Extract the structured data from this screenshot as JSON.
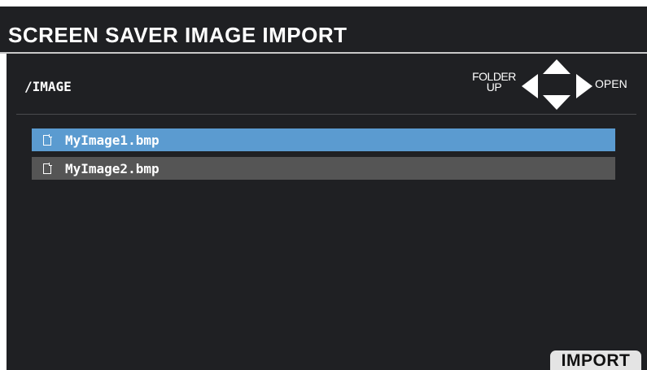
{
  "header": {
    "title": "SCREEN SAVER IMAGE IMPORT"
  },
  "browser": {
    "path": "/IMAGE",
    "nav": {
      "folder_up_line1": "FOLDER",
      "folder_up_line2": "UP",
      "open_label": "OPEN"
    },
    "files": [
      {
        "name": "MyImage1.bmp",
        "icon": "file-icon",
        "selected": true
      },
      {
        "name": "MyImage2.bmp",
        "icon": "file-icon",
        "selected": false
      }
    ]
  },
  "footer": {
    "import_label": "IMPORT"
  },
  "colors": {
    "background": "#1f2023",
    "selected_row": "#5b9bd0",
    "normal_row": "#555555",
    "button_bg": "#e4e4e4",
    "text": "#ffffff"
  }
}
